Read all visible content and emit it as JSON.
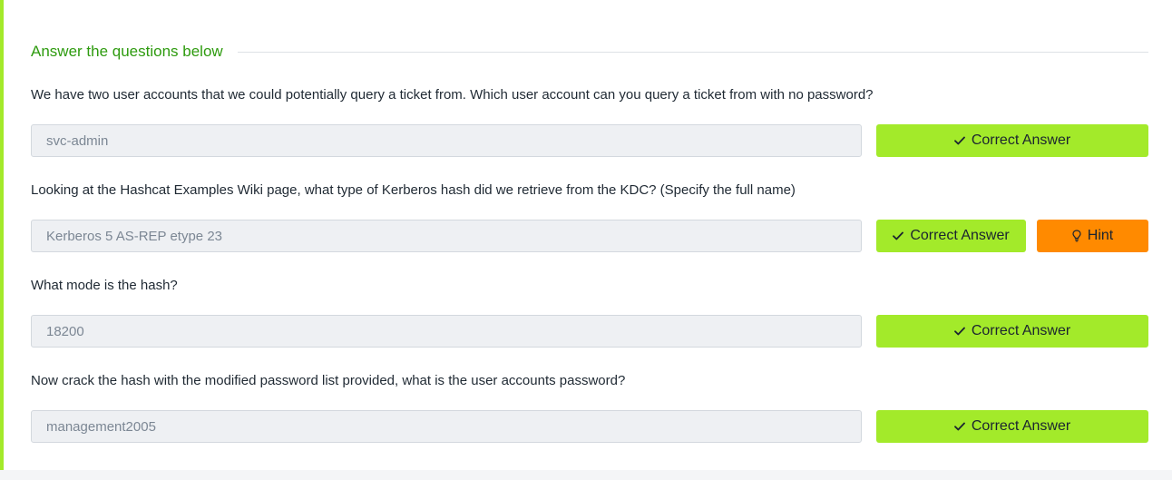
{
  "section": {
    "title": "Answer the questions below"
  },
  "questions": [
    {
      "text": "We have two user accounts that we could potentially query a ticket from. Which user account can you query a ticket from with no password?",
      "answer": "svc-admin",
      "button_label": "Correct Answer"
    },
    {
      "text": "Looking at the Hashcat Examples Wiki page, what type of Kerberos hash did we retrieve from the KDC? (Specify the full name)",
      "answer": "Kerberos 5 AS-REP etype 23",
      "button_label": "Correct Answer",
      "hint_label": "Hint"
    },
    {
      "text": "What mode is the hash?",
      "answer": "18200",
      "button_label": "Correct Answer"
    },
    {
      "text": "Now crack the hash with the modified password list provided, what is the user accounts password?",
      "answer": "management2005",
      "button_label": "Correct Answer"
    }
  ],
  "colors": {
    "accent": "#a3ea2a",
    "title_green": "#2e9b0f",
    "hint_orange": "#ff8a00"
  },
  "icons": {
    "correct": "check-icon",
    "hint": "lightbulb-icon"
  }
}
